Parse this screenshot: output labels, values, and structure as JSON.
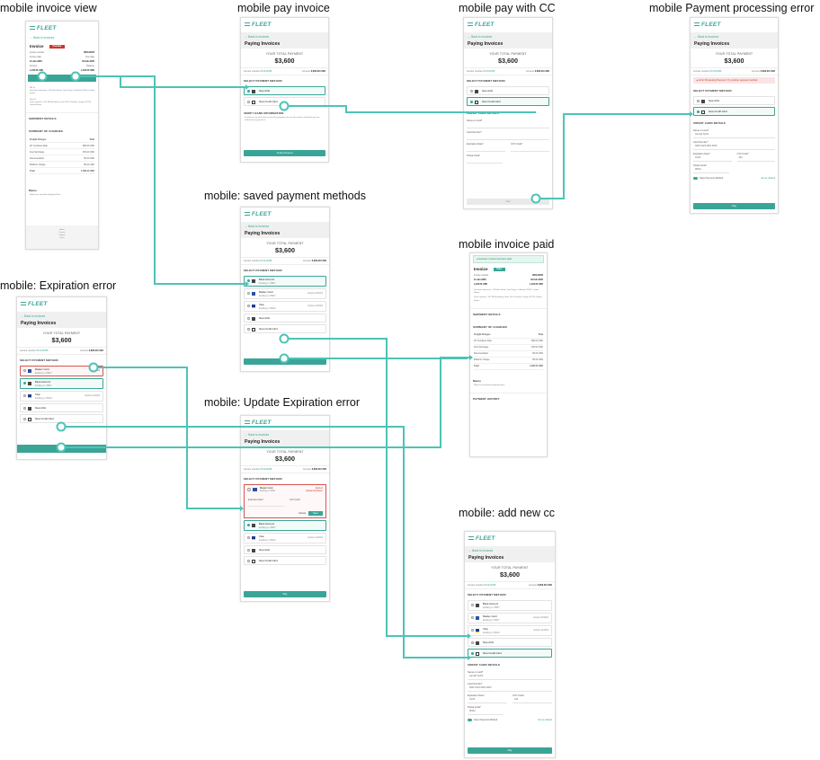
{
  "titles": {
    "invoice_view": "mobile invoice view",
    "pay_invoice": "mobile pay invoice",
    "pay_cc": "mobile pay with CC",
    "processing_error": "mobile Payment processing error",
    "saved_methods": "mobile: saved payment methods",
    "expiration_error": "mobile: Expiration error",
    "invoice_paid": "mobile invoice paid",
    "update_exp_error": "mobile: Update Expiration error",
    "add_new_cc": "mobile: add new cc"
  },
  "common": {
    "logo": "FLEET",
    "back": "← Back to invoices",
    "page_title": "Paying Invoices",
    "total_label": "YOUR TOTAL PAYMENT",
    "total": "$3,600",
    "invoice_number_label": "Invoice number",
    "invoice_number": "INV123456",
    "amount_label": "Amount",
    "amount": "3,600.00 USD",
    "select_method": "SELECT PAYMENT METHOD",
    "new_ach": "New ACH",
    "new_cc": "New Credit Card",
    "bank_account": "Bank Account",
    "bank_sub": "Ending in 4567",
    "master_card": "Master Card",
    "master_sub": "Ending in 6667",
    "visa": "Visa",
    "visa_sub": "Ending in 6644",
    "expires_a": "Expires 02/2021",
    "expires_b": "Expires 11/2024",
    "pay": "Pay",
    "cc_details": "CREDIT CARD DETAILS",
    "name_on_card": "Name on card*",
    "card_number": "Card Number*",
    "expiration_date": "Expiration Date*",
    "cvv": "CVV Code*",
    "postal_code": "Postal Code*",
    "save_method": "Save Payment Method",
    "set_default": "Set as default",
    "name_value": "Jannah Smith",
    "card_value": "0000 0123 0004 4000",
    "exp_value": "01/23",
    "cvv_value": "344",
    "postal_value": "95112"
  },
  "invoice": {
    "title": "Invoice",
    "status_unpaid": "Overdue",
    "status_paid": "Paid",
    "pay_button": "Pay Invoice",
    "date_label": "Invoice date",
    "date": "21-Jan-2020",
    "due_label": "Due date",
    "due": "02-Feb-2020",
    "amount_label": "Amount",
    "amount": "1,234.56 USD",
    "balance_label": "Balance",
    "balance": "1,234.56 USD",
    "bill_to": "Bill To",
    "bill_to_value": "Sunshine Industries, 123 Main Street, San Diego, California 92101, United States",
    "ship_to": "Ship To",
    "ship_to_value": "Pearl Logistics, 321 NE Broadway, Suite 100, Portland, Oregon 97232, United States",
    "shipment_details": "SHIPMENT DETAILS",
    "summary": "SUMMARY OF CHARGES",
    "freight_charges": "Freight Charges",
    "total_col": "Total",
    "charges": [
      {
        "label": "20' Container Rate",
        "value": "800.00 USD"
      },
      {
        "label": "Fuel Surcharge",
        "value": "150.00 USD"
      },
      {
        "label": "Documentation",
        "value": "50.00 USD"
      },
      {
        "label": "Platform Charge",
        "value": "80.00 USD"
      }
    ],
    "total_label": "Total",
    "total_value": "1,080.00 USD",
    "memo_label": "Memo",
    "memo_text": "Memo text would be displayed here",
    "history": "PAYMENT HISTORY",
    "success": "Success: Invoice has been paid.",
    "footer": [
      "About",
      "Careers",
      "Support",
      "Terms",
      "Blog",
      "Contact",
      "Privacy"
    ]
  },
  "ach_info": {
    "title": "VERIFY BANK INFORMATION",
    "text": "In order to use your bank account for payments we just first need to verify that you are authorized to pay with it.",
    "button": "Verify Account"
  },
  "errors": {
    "processing": "Error Processing Payment: Try another payment method.",
    "expired": "Expired",
    "update_exp": "Update Expiration",
    "cancel": "Cancel",
    "save": "Save"
  }
}
